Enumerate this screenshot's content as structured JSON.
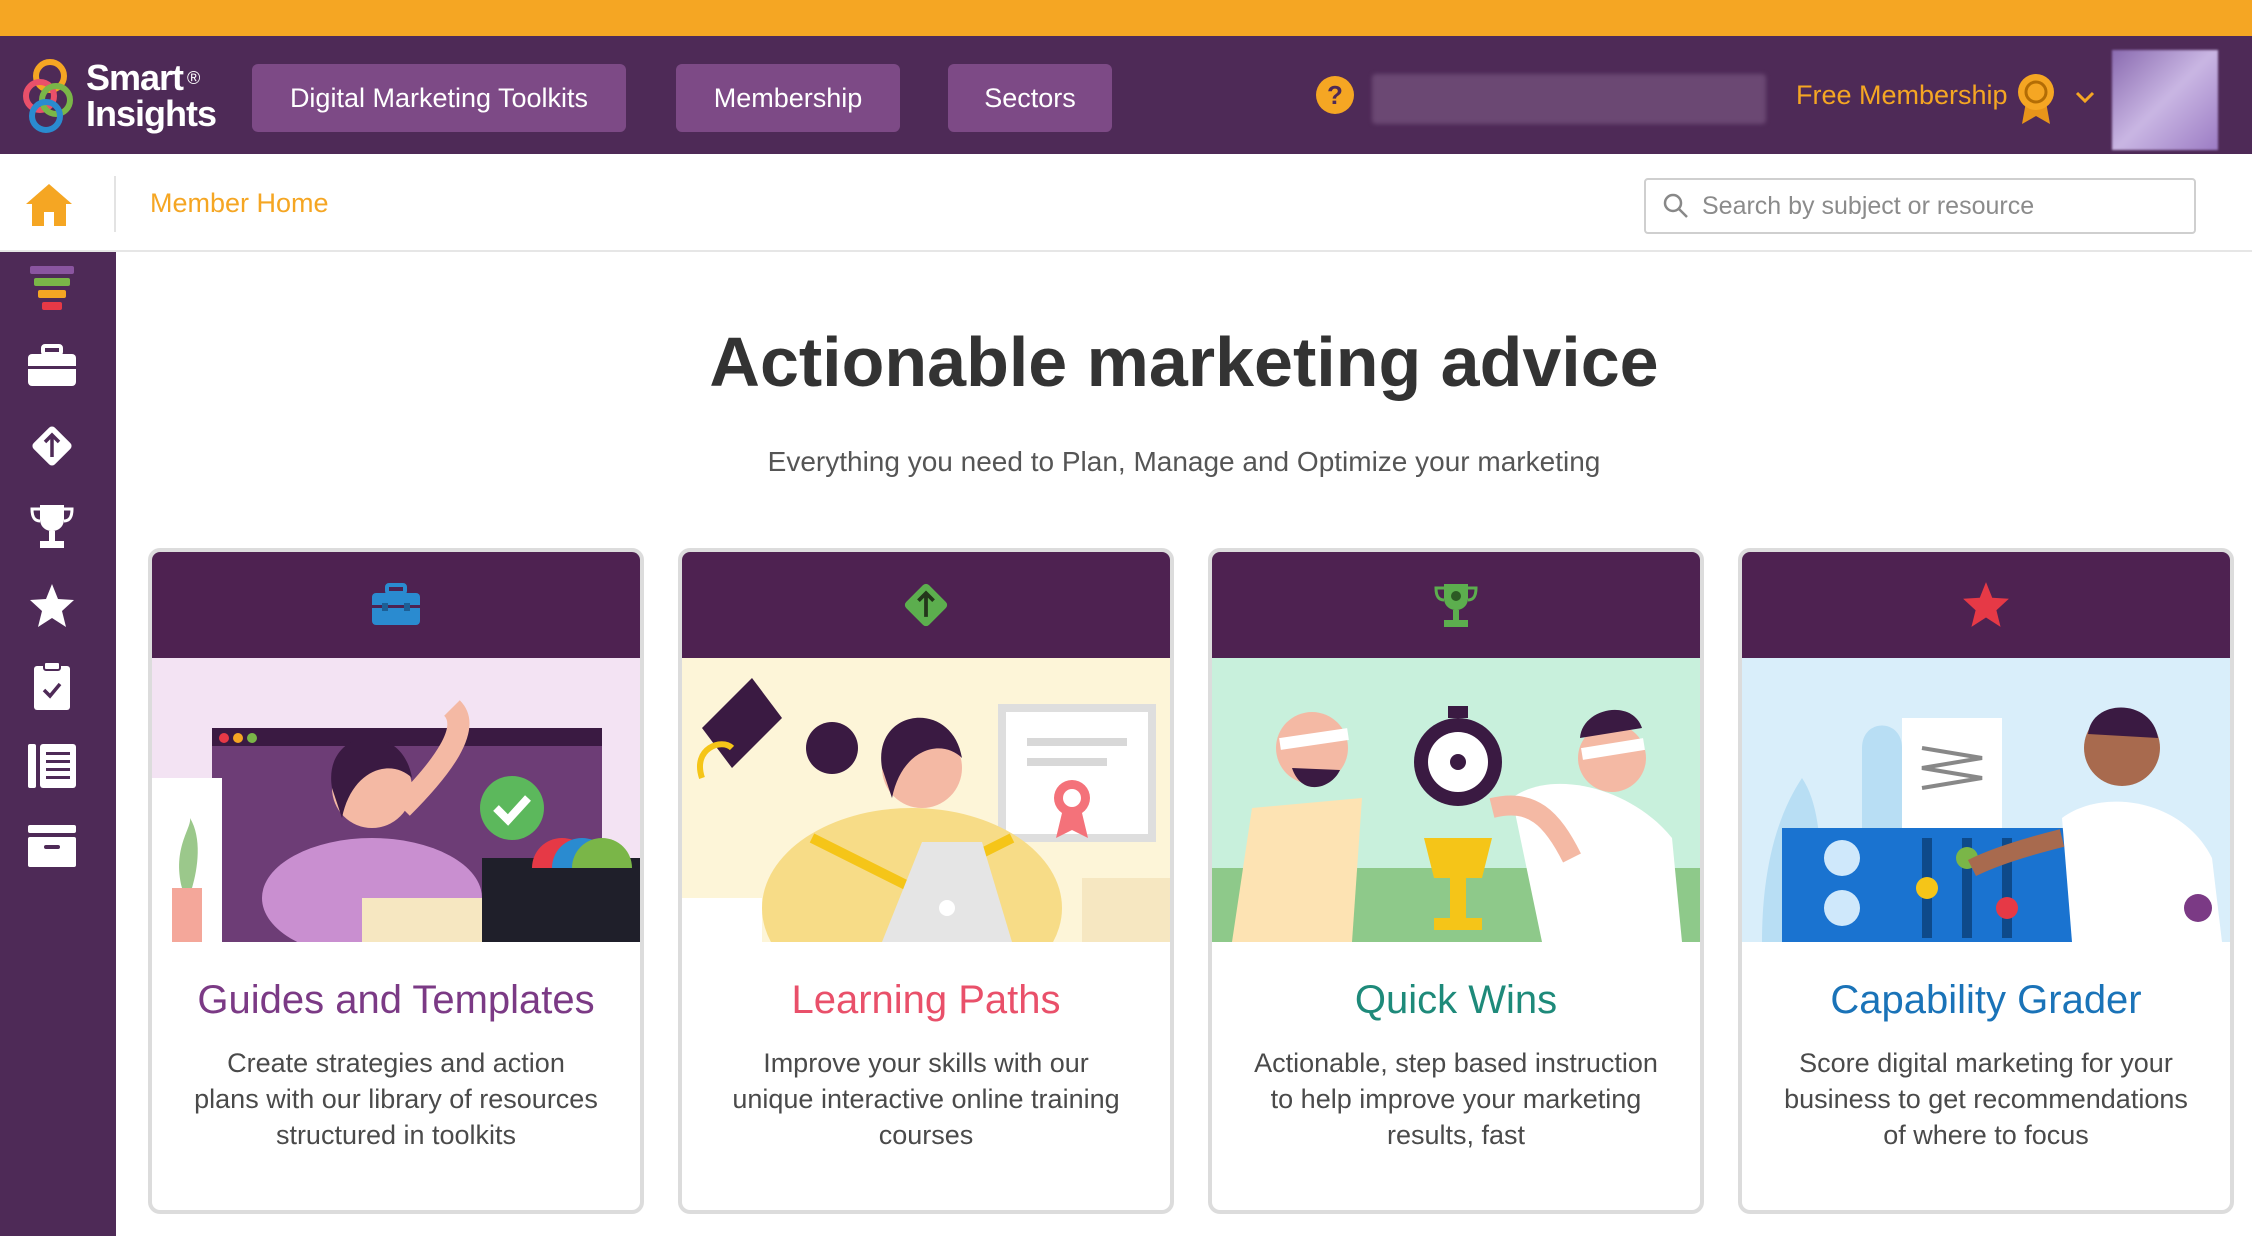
{
  "brand": {
    "line1": "Smart",
    "line2": "Insights",
    "registered": "®"
  },
  "nav": {
    "buttons": [
      {
        "label": "Digital Marketing Toolkits"
      },
      {
        "label": "Membership"
      },
      {
        "label": "Sectors"
      }
    ],
    "help": "?",
    "membership_label": "Free Membership"
  },
  "subbar": {
    "breadcrumb": "Member Home",
    "search_placeholder": "Search by subject or resource"
  },
  "sidebar": {
    "icons": [
      "funnel-icon",
      "briefcase-icon",
      "arrow-up-diamond-icon",
      "trophy-icon",
      "star-icon",
      "clipboard-icon",
      "list-icon",
      "archive-icon"
    ]
  },
  "hero": {
    "title": "Actionable marketing advice",
    "subtitle": "Everything you need to Plan, Manage and Optimize your marketing"
  },
  "cards": [
    {
      "title": "Guides and Templates",
      "description": "Create strategies and action plans with our library of resources structured in toolkits",
      "title_color": "#7b3a85",
      "icon": "briefcase-icon"
    },
    {
      "title": "Learning Paths",
      "description": "Improve your skills with our unique interactive online training courses",
      "title_color": "#e9506a",
      "icon": "arrow-up-diamond-icon"
    },
    {
      "title": "Quick Wins",
      "description": "Actionable, step based instruction to help improve your marketing results, fast",
      "title_color": "#1e8a7a",
      "icon": "trophy-icon"
    },
    {
      "title": "Capability Grader",
      "description": "Score digital marketing for your business to get recommendations of where to focus",
      "title_color": "#1a73b8",
      "icon": "star-icon"
    }
  ],
  "colors": {
    "accent": "#f5a623",
    "nav_bg": "#4e2a57",
    "nav_button": "#7d4a86",
    "card_header": "#4e2251"
  }
}
